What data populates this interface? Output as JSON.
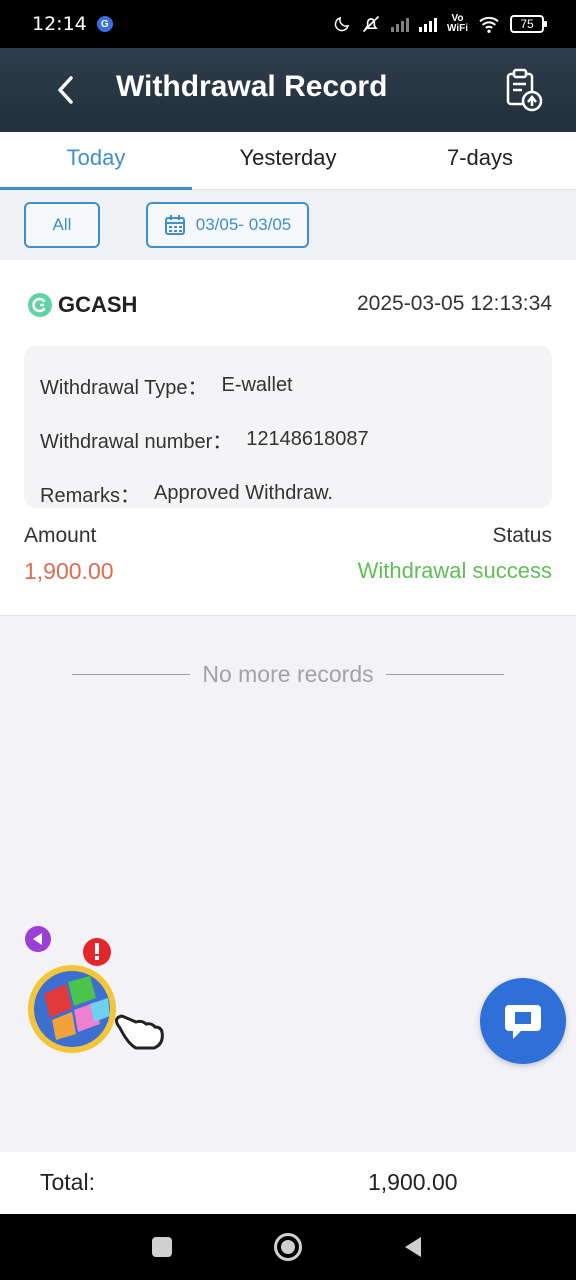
{
  "status_bar": {
    "time": "12:14",
    "g_badge": "G",
    "vowifi_top": "Vo",
    "vowifi_bottom": "WiFi",
    "battery": "75"
  },
  "header": {
    "title": "Withdrawal Record",
    "back_icon": "chevron-left-icon",
    "action_icon": "clipboard-upload-icon"
  },
  "tabs": [
    {
      "label": "Today",
      "active": true
    },
    {
      "label": "Yesterday",
      "active": false
    },
    {
      "label": "7-days",
      "active": false
    }
  ],
  "filters": {
    "all_label": "All",
    "date_range": "03/05- 03/05",
    "date_icon": "calendar-icon"
  },
  "record": {
    "provider": "GCASH",
    "datetime": "2025-03-05 12:13:34",
    "type_label": "Withdrawal Type：",
    "type_value": "E-wallet",
    "number_label": "Withdrawal number：",
    "number_value": "12148618087",
    "remarks_label": "Remarks：",
    "remarks_value": "Approved Withdraw.",
    "amount_label": "Amount",
    "amount_value": "1,900.00",
    "status_label": "Status",
    "status_value": "Withdrawal success"
  },
  "no_more": "No more records",
  "footer": {
    "total_label": "Total:",
    "total_value": "1,900.00"
  },
  "colors": {
    "accent": "#3f8fcf",
    "amount": "#d96d4f",
    "success": "#5fbf55",
    "header_bg": "#2a3846",
    "chat": "#2f6fd8"
  }
}
